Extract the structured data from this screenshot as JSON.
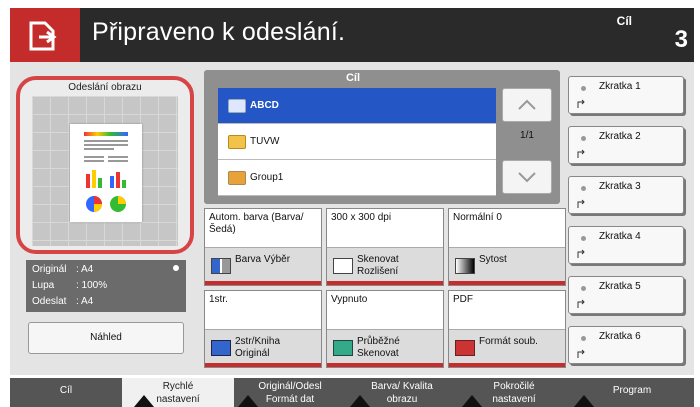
{
  "header": {
    "title": "Připraveno k odeslání.",
    "dest_label": "Cíl",
    "dest_count": "3"
  },
  "preview": {
    "title": "Odeslání obrazu",
    "info": [
      {
        "key": "Originál",
        "value": ":  A4"
      },
      {
        "key": "Lupa",
        "value": ":  100%"
      },
      {
        "key": "Odeslat",
        "value": ":  A4"
      }
    ],
    "button": "Náhled"
  },
  "destination": {
    "header": "Cíl",
    "items": [
      {
        "label": "ABCD",
        "icon": "email-icon"
      },
      {
        "label": "TUVW",
        "icon": "folder-user-icon"
      },
      {
        "label": "Group1",
        "icon": "group-icon"
      }
    ],
    "pager": "1/1"
  },
  "settings": [
    {
      "top": "Autom. barva (Barva/Šedá)",
      "bottom": "Barva Výběr",
      "icon": "color-select-icon"
    },
    {
      "top": "300 x 300 dpi",
      "bottom": "Skenovat Rozlišení",
      "icon": "resolution-icon"
    },
    {
      "top": "Normální 0",
      "bottom": "Sytost",
      "icon": "density-icon"
    },
    {
      "top": "1str.",
      "bottom": "2str/Kniha Originál",
      "icon": "duplex-icon"
    },
    {
      "top": "Vypnuto",
      "bottom": "Průběžné Skenovat",
      "icon": "continuous-scan-icon"
    },
    {
      "top": "PDF",
      "bottom": "Formát soub.",
      "icon": "file-format-icon"
    }
  ],
  "shortcuts": [
    "Zkratka 1",
    "Zkratka 2",
    "Zkratka 3",
    "Zkratka 4",
    "Zkratka 5",
    "Zkratka 6"
  ],
  "tabs": [
    {
      "label": "Cíl",
      "active": false
    },
    {
      "label": "Rychlé nastavení",
      "active": true
    },
    {
      "label": "Originál/Odesl Formát dat",
      "active": false
    },
    {
      "label": "Barva/ Kvalita obrazu",
      "active": false
    },
    {
      "label": "Pokročilé nastavení",
      "active": false
    },
    {
      "label": "Program",
      "active": false
    }
  ],
  "colors": {
    "accent": "#c42b2b",
    "selection": "#2457c5",
    "header_bg": "#2a2a2a"
  }
}
